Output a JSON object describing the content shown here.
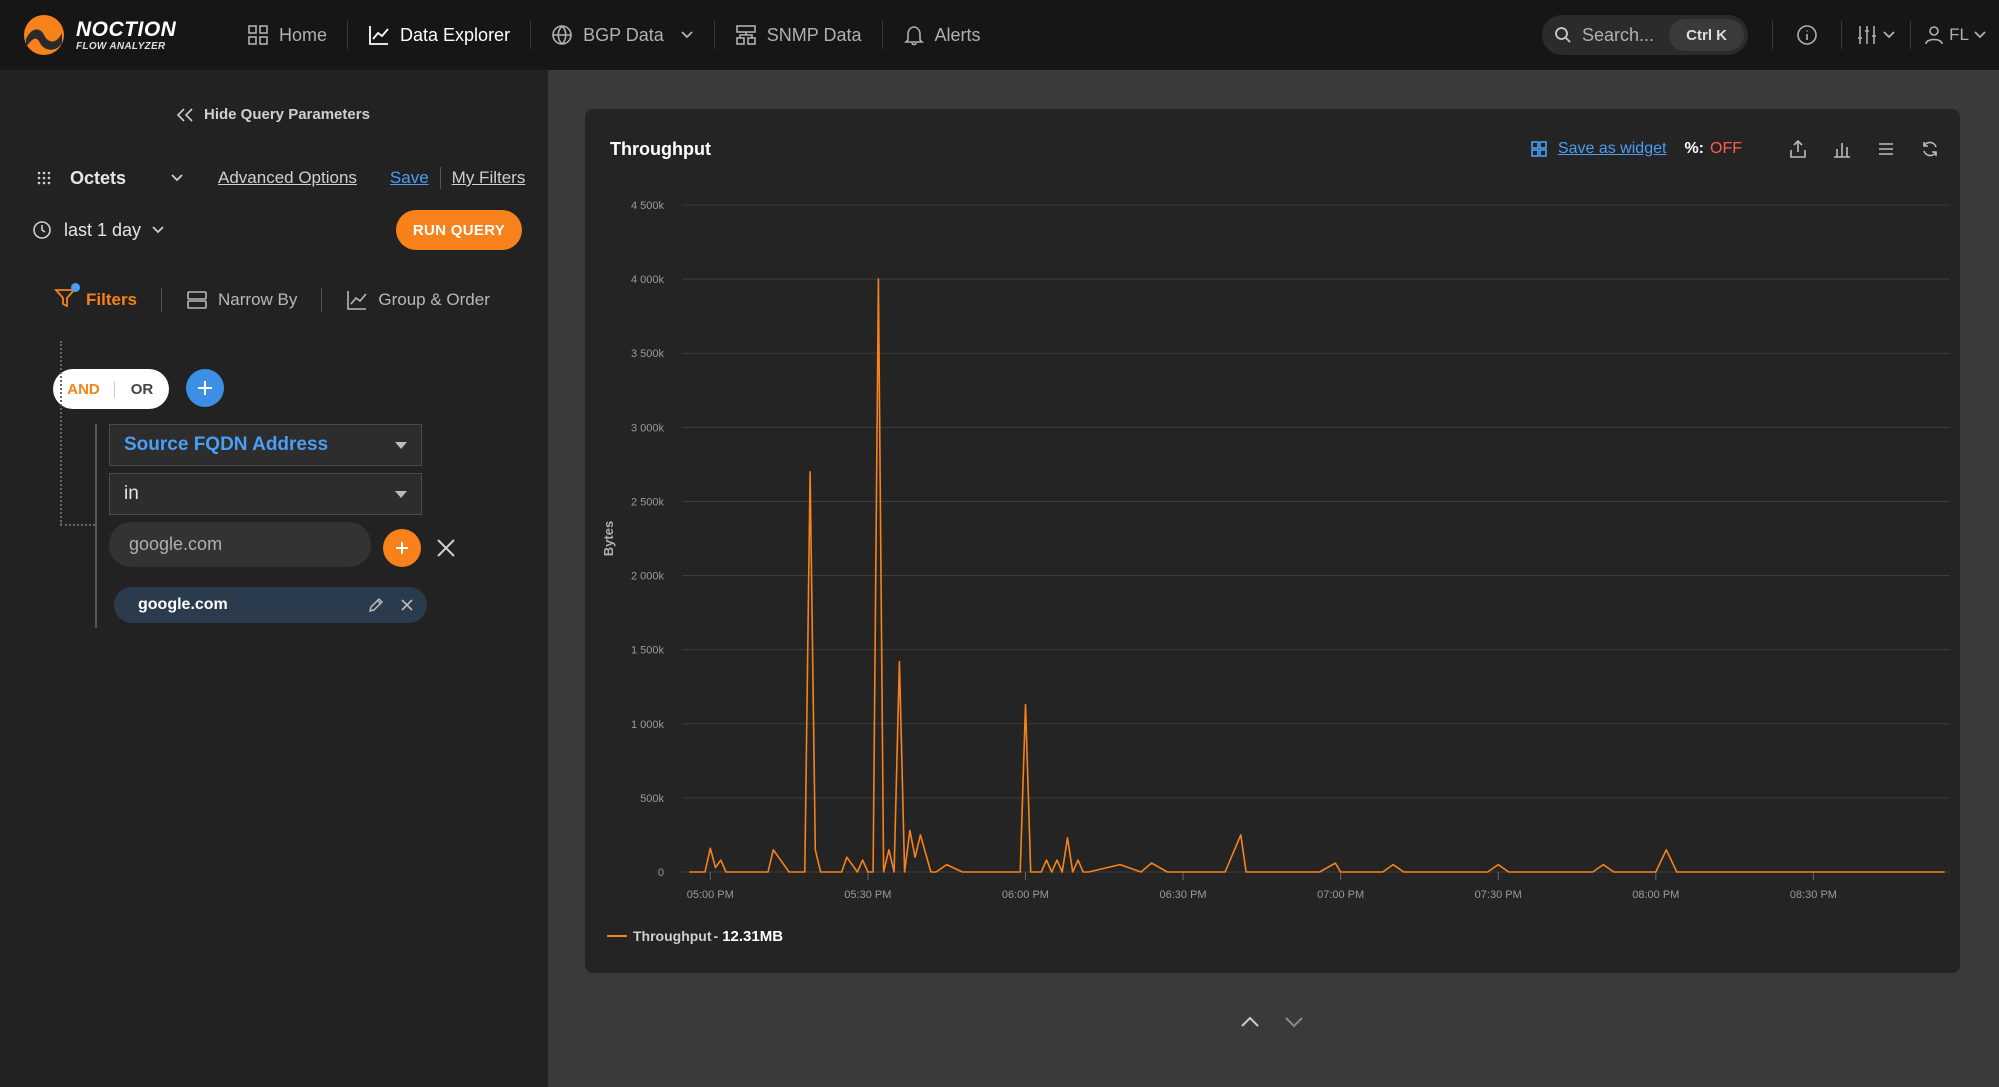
{
  "app": {
    "brand_line1": "NOCTION",
    "brand_line2": "FLOW ANALYZER"
  },
  "nav": {
    "items": [
      {
        "label": "Home",
        "icon": "home-grid-icon"
      },
      {
        "label": "Data Explorer",
        "icon": "chart-line-icon",
        "active": true
      },
      {
        "label": "BGP Data",
        "icon": "globe-icon",
        "has_dropdown": true
      },
      {
        "label": "SNMP Data",
        "icon": "network-icon"
      },
      {
        "label": "Alerts",
        "icon": "bell-icon"
      }
    ]
  },
  "search": {
    "placeholder": "Search...",
    "shortcut": "Ctrl K"
  },
  "user": {
    "initials": "FL"
  },
  "query": {
    "hide_label": "Hide Query Parameters",
    "metric": "Octets",
    "advanced_options": "Advanced Options",
    "save": "Save",
    "my_filters": "My Filters",
    "period": "last 1 day",
    "run_button": "RUN QUERY"
  },
  "tabs": [
    {
      "label": "Filters",
      "icon": "filter-icon",
      "active": true
    },
    {
      "label": "Narrow By",
      "icon": "server-icon"
    },
    {
      "label": "Group & Order",
      "icon": "chart-icon"
    }
  ],
  "filter": {
    "and_label": "AND",
    "or_label": "OR",
    "field": "Source FQDN Address",
    "operator": "in",
    "input_placeholder": "google.com",
    "values": [
      "google.com"
    ]
  },
  "card": {
    "title": "Throughput",
    "save_widget": "Save as widget",
    "pct_label": "%:",
    "pct_value": "OFF"
  },
  "colors": {
    "accent": "#f7821b",
    "link": "#4a9ef5",
    "off": "#ff5b4d"
  },
  "chart_data": {
    "type": "line",
    "ylabel": "Bytes",
    "ylim": [
      0,
      4500000
    ],
    "yticks": [
      0,
      500000,
      1000000,
      1500000,
      2000000,
      2500000,
      3000000,
      3500000,
      4000000,
      4500000
    ],
    "ytick_labels": [
      "0",
      "500k",
      "1 000k",
      "1 500k",
      "2 000k",
      "2 500k",
      "3 000k",
      "3 500k",
      "4 000k",
      "4 500k"
    ],
    "xtick_labels": [
      "05:00 PM",
      "05:30 PM",
      "06:00 PM",
      "06:30 PM",
      "07:00 PM",
      "07:30 PM",
      "08:00 PM",
      "08:30 PM"
    ],
    "xtick_minutes": [
      0,
      30,
      60,
      90,
      120,
      150,
      180,
      210
    ],
    "xlim_minutes": [
      -5,
      236
    ],
    "series": [
      {
        "name": "Throughput",
        "total": "12.31MB",
        "color": "#f7821b",
        "x": [
          -4,
          -1,
          0,
          1,
          2,
          3,
          5,
          7,
          11,
          12,
          15,
          18,
          19,
          20,
          21,
          23,
          24,
          25,
          26,
          28,
          29,
          30,
          31,
          32,
          33,
          34,
          35,
          36,
          37,
          38,
          39,
          40,
          42,
          43,
          45,
          48,
          59,
          60,
          61,
          63,
          64,
          65,
          66,
          67,
          68,
          69,
          70,
          71,
          72,
          78,
          82,
          84,
          87,
          98,
          101,
          102,
          104,
          116,
          119,
          120,
          122,
          128,
          130,
          132,
          148,
          150,
          152,
          168,
          170,
          172,
          180,
          182,
          184,
          198,
          200,
          202,
          224,
          235
        ],
        "y": [
          0,
          0,
          160000,
          30000,
          80000,
          0,
          0,
          0,
          0,
          150000,
          0,
          0,
          2700000,
          150000,
          0,
          0,
          0,
          0,
          100000,
          0,
          80000,
          0,
          0,
          4000000,
          0,
          150000,
          0,
          1420000,
          0,
          280000,
          100000,
          250000,
          0,
          0,
          50000,
          0,
          0,
          1130000,
          0,
          0,
          80000,
          0,
          80000,
          0,
          230000,
          0,
          80000,
          0,
          0,
          50000,
          0,
          60000,
          0,
          0,
          250000,
          0,
          0,
          0,
          60000,
          0,
          0,
          0,
          50000,
          0,
          0,
          50000,
          0,
          0,
          50000,
          0,
          0,
          150000,
          0,
          0,
          0,
          0,
          0,
          0
        ]
      }
    ]
  }
}
